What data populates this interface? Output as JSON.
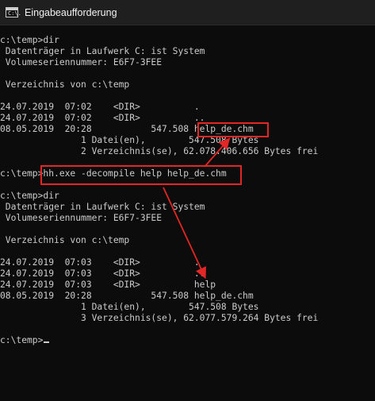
{
  "window": {
    "title": "Eingabeaufforderung",
    "icon": "cmd-icon",
    "icon_text": "C:\\."
  },
  "console": {
    "lines": [
      "c:\\temp>dir",
      " Datenträger in Laufwerk C: ist System",
      " Volumeseriennummer: E6F7-3FEE",
      "",
      " Verzeichnis von c:\\temp",
      "",
      "24.07.2019  07:02    <DIR>          .",
      "24.07.2019  07:02    <DIR>          ..",
      "08.05.2019  20:28           547.508 help_de.chm",
      "               1 Datei(en),        547.508 Bytes",
      "               2 Verzeichnis(se), 62.078.406.656 Bytes frei",
      "",
      "c:\\temp>hh.exe -decompile help help_de.chm",
      "",
      "c:\\temp>dir",
      " Datenträger in Laufwerk C: ist System",
      " Volumeseriennummer: E6F7-3FEE",
      "",
      " Verzeichnis von c:\\temp",
      "",
      "24.07.2019  07:03    <DIR>          .",
      "24.07.2019  07:03    <DIR>          ..",
      "24.07.2019  07:03    <DIR>          help",
      "08.05.2019  20:28           547.508 help_de.chm",
      "               1 Datei(en),        547.508 Bytes",
      "               3 Verzeichnis(se), 62.077.579.264 Bytes frei",
      "",
      "c:\\temp>"
    ]
  },
  "colors": {
    "background": "#0c0c0c",
    "text": "#cccccc",
    "annotation": "#e32626"
  }
}
